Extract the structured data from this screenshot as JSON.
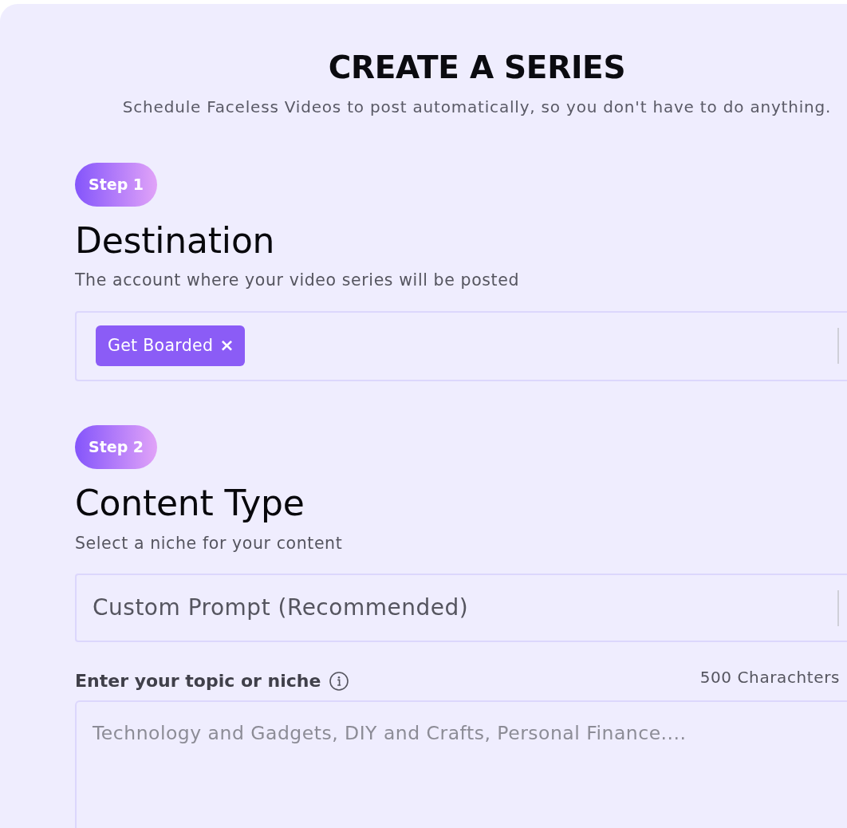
{
  "header": {
    "title": "CREATE A SERIES",
    "subtitle": "Schedule Faceless Videos to post automatically, so you don't have to do anything."
  },
  "steps": [
    {
      "badge": "Step 1",
      "title": "Destination",
      "description": "The account where your video series will be posted",
      "field": {
        "kind": "multi_select",
        "tags": [
          {
            "label": "Get Boarded",
            "remove": "×"
          }
        ]
      }
    },
    {
      "badge": "Step 2",
      "title": "Content Type",
      "description": "Select a niche for your content",
      "field": {
        "kind": "select",
        "value": "Custom Prompt (Recommended)"
      },
      "prompt": {
        "label": "Enter your topic or niche",
        "counter": "500 Charachters",
        "placeholder": "Technology and Gadgets, DIY and Crafts, Personal Finance...."
      }
    }
  ]
}
